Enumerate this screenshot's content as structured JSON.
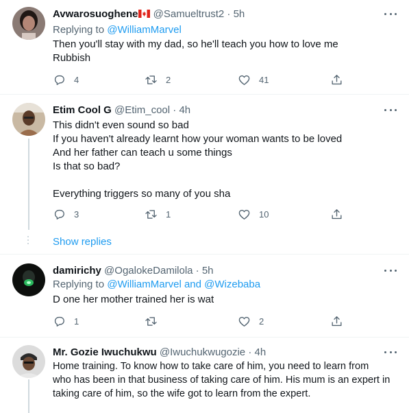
{
  "tweets": [
    {
      "name": "Avwarosuoghene",
      "handle": "@Samueltrust2",
      "time": "5h",
      "replying_label": "Replying to",
      "replying_to": [
        "@WilliamMarvel"
      ],
      "lines": [
        "Then you'll stay with my dad, so he'll teach you how to love me",
        "Rubbish"
      ],
      "replies": "4",
      "retweets": "2",
      "likes": "41"
    },
    {
      "name": "Etim Cool G",
      "handle": "@Etim_cool",
      "time": "4h",
      "lines": [
        "This didn't even sound so bad",
        "If you haven't already learnt how your woman wants to be loved",
        "And her father can teach u some things",
        "Is that so bad?",
        "",
        "Everything triggers so many of you sha"
      ],
      "replies": "3",
      "retweets": "1",
      "likes": "10"
    },
    {
      "name": "damirichy",
      "handle": "@OgalokeDamilola",
      "time": "5h",
      "replying_label": "Replying to",
      "replying_to": [
        "@WilliamMarvel",
        "@Wizebaba"
      ],
      "replying_and": "and",
      "lines": [
        "D one her mother trained her is wat"
      ],
      "replies": "1",
      "retweets": "",
      "likes": "2"
    },
    {
      "name": "Mr. Gozie Iwuchukwu",
      "handle": "@Iwuchukwugozie",
      "time": "4h",
      "lines": [
        "Home training. To know how to take care of him, you need to learn from",
        "who has been in that business of taking care of him. His mum is an expert in",
        "taking care of him, so the wife got to learn from the expert."
      ]
    }
  ],
  "show_replies": "Show replies",
  "separator": "·",
  "colors": {
    "accent": "#1d9bf0",
    "secondary": "#536471",
    "text": "#0f1419",
    "divider": "#eff3f4"
  }
}
